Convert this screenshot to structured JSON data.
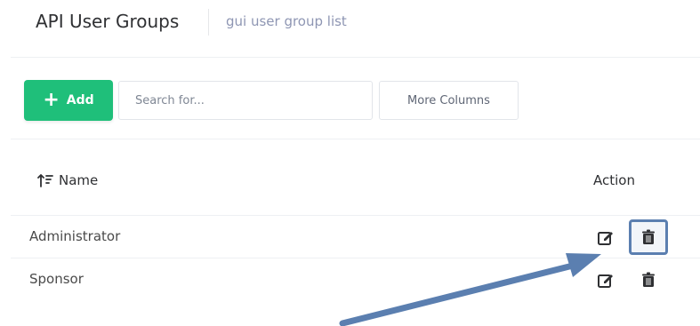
{
  "header": {
    "title": "API User Groups",
    "subtitle": "gui user group list"
  },
  "toolbar": {
    "add_label": "Add",
    "search_placeholder": "Search for...",
    "more_columns_label": "More Columns"
  },
  "table": {
    "columns": {
      "name": "Name",
      "action": "Action"
    },
    "rows": [
      {
        "name": "Administrator"
      },
      {
        "name": "Sponsor"
      }
    ]
  },
  "colors": {
    "add_button": "#1fbf7a",
    "highlight_arrow": "#5b7fb0"
  },
  "icons": {
    "sort": "sort-icon",
    "edit": "edit-icon",
    "delete": "trash-icon",
    "add": "plus-icon"
  }
}
